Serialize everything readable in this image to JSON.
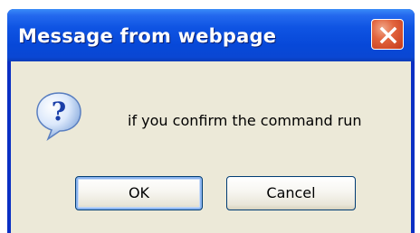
{
  "dialog": {
    "title": "Message from webpage",
    "message": "if you confirm the command run",
    "icon": "question-icon",
    "buttons": {
      "ok_label": "OK",
      "cancel_label": "Cancel"
    },
    "colors": {
      "titlebar": "#0a47d3",
      "client_background": "#ece9d8",
      "close_button": "#e2643d"
    }
  }
}
